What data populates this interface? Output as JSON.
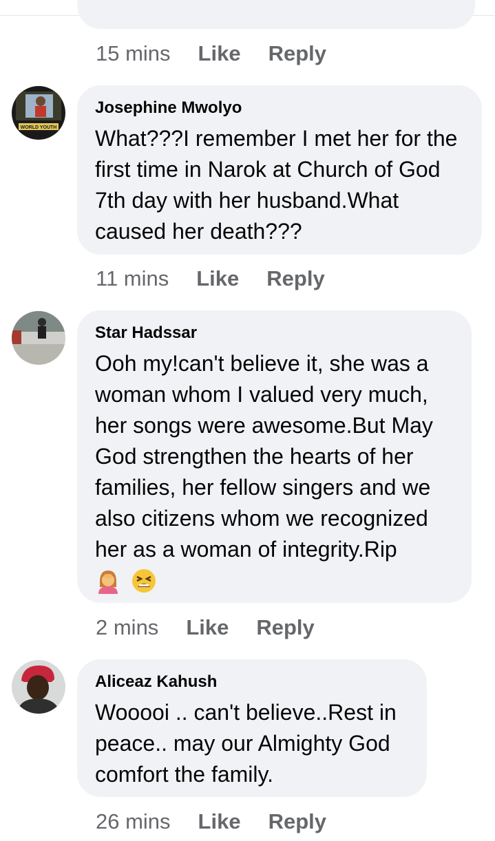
{
  "previous": {
    "time": "15 mins",
    "like": "Like",
    "reply": "Reply"
  },
  "comments": [
    {
      "author": "Josephine Mwolyo",
      "text": "What???I remember I met her for the first time in Narok at Church of God 7th day with her husband.What caused her death???",
      "time": "11 mins",
      "like": "Like",
      "reply": "Reply",
      "avatar_banner": "WORLD YOUTH"
    },
    {
      "author": "Star Hadssar",
      "text": "Ooh my!can't believe it, she was a woman whom I valued very much, her songs were awesome.But May God strengthen the hearts of her families, her fellow singers and we also citizens whom we recognized her as a woman of integrity.Rip",
      "emojis": [
        "woman-facepalming-emoji",
        "tired-face-emoji"
      ],
      "time": "2 mins",
      "like": "Like",
      "reply": "Reply"
    },
    {
      "author": "Aliceaz Kahush",
      "text": "Wooooi .. can't believe..Rest in peace.. may our Almighty God comfort the family.",
      "time": "26 mins",
      "like": "Like",
      "reply": "Reply"
    }
  ],
  "colors": {
    "bubble": "#f0f2f5",
    "meta": "#65676b",
    "text": "#050505"
  }
}
